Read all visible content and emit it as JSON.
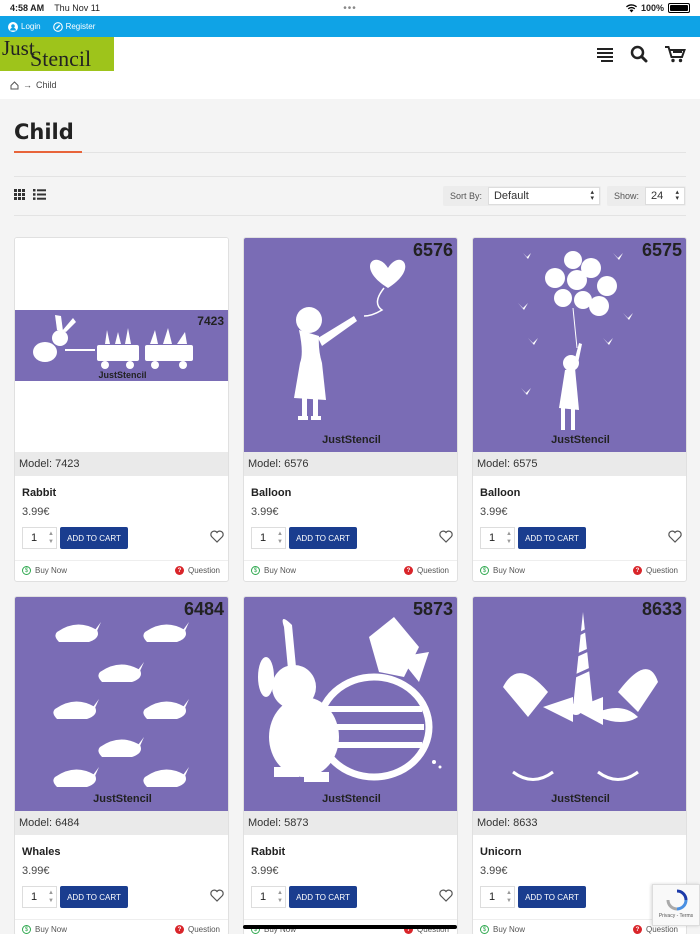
{
  "status_bar": {
    "time": "4:58 AM",
    "date": "Thu Nov 11",
    "battery": "100%"
  },
  "top_bar": {
    "login": "Login",
    "register": "Register",
    "accent": "#0fa3e6"
  },
  "logo": {
    "line1": "Just",
    "line2": "Stencil"
  },
  "breadcrumb": {
    "separator": "→",
    "current": "Child"
  },
  "page": {
    "title": "Child"
  },
  "toolbar": {
    "sort_label": "Sort By:",
    "sort_value": "Default",
    "show_label": "Show:",
    "show_value": "24"
  },
  "products": [
    {
      "code": "7423",
      "model": "Model: 7423",
      "name": "Rabbit",
      "price": "3.99€",
      "qty": "1",
      "brand": "JustStencil"
    },
    {
      "code": "6576",
      "model": "Model: 6576",
      "name": "Balloon",
      "price": "3.99€",
      "qty": "1",
      "brand": "JustStencil"
    },
    {
      "code": "6575",
      "model": "Model: 6575",
      "name": "Balloon",
      "price": "3.99€",
      "qty": "1",
      "brand": "JustStencil"
    },
    {
      "code": "6484",
      "model": "Model: 6484",
      "name": "Whales",
      "price": "3.99€",
      "qty": "1",
      "brand": "JustStencil"
    },
    {
      "code": "5873",
      "model": "Model: 5873",
      "name": "Rabbit",
      "price": "3.99€",
      "qty": "1",
      "brand": "JustStencil"
    },
    {
      "code": "8633",
      "model": "Model: 8633",
      "name": "Unicorn",
      "price": "3.99€",
      "qty": "1",
      "brand": "JustStencil"
    }
  ],
  "card_labels": {
    "add_to_cart": "ADD TO CART",
    "buy_now": "Buy Now",
    "question": "Question"
  },
  "recaptcha": "Privacy - Terms",
  "colors": {
    "stencil_bg": "#7a6cb5",
    "button": "#1a3d8f",
    "title_accent": "#e8643a",
    "logo_bg": "#9ec41b"
  }
}
